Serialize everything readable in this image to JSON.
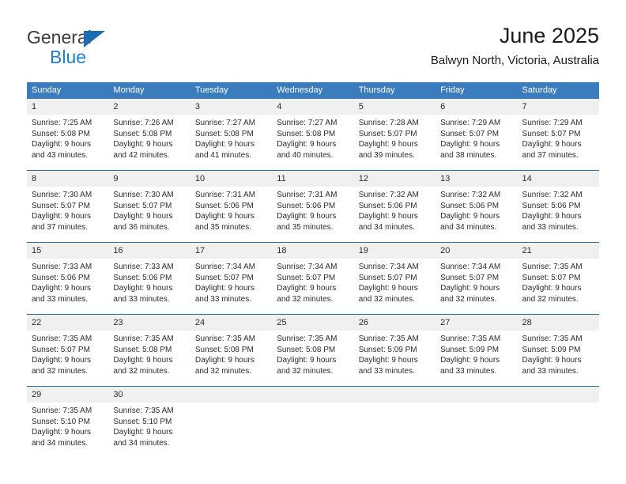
{
  "brand": {
    "name_top": "General",
    "name_bottom": "Blue",
    "accent_color": "#1b7fd4",
    "triangle_color": "#1b6cb3"
  },
  "header": {
    "title": "June 2025",
    "subtitle": "Balwyn North, Victoria, Australia"
  },
  "calendar": {
    "header_bg": "#3a7cbe",
    "header_text_color": "#ffffff",
    "daynum_bg": "#f0f0f0",
    "weekday_headers": [
      "Sunday",
      "Monday",
      "Tuesday",
      "Wednesday",
      "Thursday",
      "Friday",
      "Saturday"
    ],
    "weeks": [
      [
        {
          "day": "1",
          "sunrise": "Sunrise: 7:25 AM",
          "sunset": "Sunset: 5:08 PM",
          "daylight_line1": "Daylight: 9 hours",
          "daylight_line2": "and 43 minutes."
        },
        {
          "day": "2",
          "sunrise": "Sunrise: 7:26 AM",
          "sunset": "Sunset: 5:08 PM",
          "daylight_line1": "Daylight: 9 hours",
          "daylight_line2": "and 42 minutes."
        },
        {
          "day": "3",
          "sunrise": "Sunrise: 7:27 AM",
          "sunset": "Sunset: 5:08 PM",
          "daylight_line1": "Daylight: 9 hours",
          "daylight_line2": "and 41 minutes."
        },
        {
          "day": "4",
          "sunrise": "Sunrise: 7:27 AM",
          "sunset": "Sunset: 5:08 PM",
          "daylight_line1": "Daylight: 9 hours",
          "daylight_line2": "and 40 minutes."
        },
        {
          "day": "5",
          "sunrise": "Sunrise: 7:28 AM",
          "sunset": "Sunset: 5:07 PM",
          "daylight_line1": "Daylight: 9 hours",
          "daylight_line2": "and 39 minutes."
        },
        {
          "day": "6",
          "sunrise": "Sunrise: 7:29 AM",
          "sunset": "Sunset: 5:07 PM",
          "daylight_line1": "Daylight: 9 hours",
          "daylight_line2": "and 38 minutes."
        },
        {
          "day": "7",
          "sunrise": "Sunrise: 7:29 AM",
          "sunset": "Sunset: 5:07 PM",
          "daylight_line1": "Daylight: 9 hours",
          "daylight_line2": "and 37 minutes."
        }
      ],
      [
        {
          "day": "8",
          "sunrise": "Sunrise: 7:30 AM",
          "sunset": "Sunset: 5:07 PM",
          "daylight_line1": "Daylight: 9 hours",
          "daylight_line2": "and 37 minutes."
        },
        {
          "day": "9",
          "sunrise": "Sunrise: 7:30 AM",
          "sunset": "Sunset: 5:07 PM",
          "daylight_line1": "Daylight: 9 hours",
          "daylight_line2": "and 36 minutes."
        },
        {
          "day": "10",
          "sunrise": "Sunrise: 7:31 AM",
          "sunset": "Sunset: 5:06 PM",
          "daylight_line1": "Daylight: 9 hours",
          "daylight_line2": "and 35 minutes."
        },
        {
          "day": "11",
          "sunrise": "Sunrise: 7:31 AM",
          "sunset": "Sunset: 5:06 PM",
          "daylight_line1": "Daylight: 9 hours",
          "daylight_line2": "and 35 minutes."
        },
        {
          "day": "12",
          "sunrise": "Sunrise: 7:32 AM",
          "sunset": "Sunset: 5:06 PM",
          "daylight_line1": "Daylight: 9 hours",
          "daylight_line2": "and 34 minutes."
        },
        {
          "day": "13",
          "sunrise": "Sunrise: 7:32 AM",
          "sunset": "Sunset: 5:06 PM",
          "daylight_line1": "Daylight: 9 hours",
          "daylight_line2": "and 34 minutes."
        },
        {
          "day": "14",
          "sunrise": "Sunrise: 7:32 AM",
          "sunset": "Sunset: 5:06 PM",
          "daylight_line1": "Daylight: 9 hours",
          "daylight_line2": "and 33 minutes."
        }
      ],
      [
        {
          "day": "15",
          "sunrise": "Sunrise: 7:33 AM",
          "sunset": "Sunset: 5:06 PM",
          "daylight_line1": "Daylight: 9 hours",
          "daylight_line2": "and 33 minutes."
        },
        {
          "day": "16",
          "sunrise": "Sunrise: 7:33 AM",
          "sunset": "Sunset: 5:06 PM",
          "daylight_line1": "Daylight: 9 hours",
          "daylight_line2": "and 33 minutes."
        },
        {
          "day": "17",
          "sunrise": "Sunrise: 7:34 AM",
          "sunset": "Sunset: 5:07 PM",
          "daylight_line1": "Daylight: 9 hours",
          "daylight_line2": "and 33 minutes."
        },
        {
          "day": "18",
          "sunrise": "Sunrise: 7:34 AM",
          "sunset": "Sunset: 5:07 PM",
          "daylight_line1": "Daylight: 9 hours",
          "daylight_line2": "and 32 minutes."
        },
        {
          "day": "19",
          "sunrise": "Sunrise: 7:34 AM",
          "sunset": "Sunset: 5:07 PM",
          "daylight_line1": "Daylight: 9 hours",
          "daylight_line2": "and 32 minutes."
        },
        {
          "day": "20",
          "sunrise": "Sunrise: 7:34 AM",
          "sunset": "Sunset: 5:07 PM",
          "daylight_line1": "Daylight: 9 hours",
          "daylight_line2": "and 32 minutes."
        },
        {
          "day": "21",
          "sunrise": "Sunrise: 7:35 AM",
          "sunset": "Sunset: 5:07 PM",
          "daylight_line1": "Daylight: 9 hours",
          "daylight_line2": "and 32 minutes."
        }
      ],
      [
        {
          "day": "22",
          "sunrise": "Sunrise: 7:35 AM",
          "sunset": "Sunset: 5:07 PM",
          "daylight_line1": "Daylight: 9 hours",
          "daylight_line2": "and 32 minutes."
        },
        {
          "day": "23",
          "sunrise": "Sunrise: 7:35 AM",
          "sunset": "Sunset: 5:08 PM",
          "daylight_line1": "Daylight: 9 hours",
          "daylight_line2": "and 32 minutes."
        },
        {
          "day": "24",
          "sunrise": "Sunrise: 7:35 AM",
          "sunset": "Sunset: 5:08 PM",
          "daylight_line1": "Daylight: 9 hours",
          "daylight_line2": "and 32 minutes."
        },
        {
          "day": "25",
          "sunrise": "Sunrise: 7:35 AM",
          "sunset": "Sunset: 5:08 PM",
          "daylight_line1": "Daylight: 9 hours",
          "daylight_line2": "and 32 minutes."
        },
        {
          "day": "26",
          "sunrise": "Sunrise: 7:35 AM",
          "sunset": "Sunset: 5:09 PM",
          "daylight_line1": "Daylight: 9 hours",
          "daylight_line2": "and 33 minutes."
        },
        {
          "day": "27",
          "sunrise": "Sunrise: 7:35 AM",
          "sunset": "Sunset: 5:09 PM",
          "daylight_line1": "Daylight: 9 hours",
          "daylight_line2": "and 33 minutes."
        },
        {
          "day": "28",
          "sunrise": "Sunrise: 7:35 AM",
          "sunset": "Sunset: 5:09 PM",
          "daylight_line1": "Daylight: 9 hours",
          "daylight_line2": "and 33 minutes."
        }
      ],
      [
        {
          "day": "29",
          "sunrise": "Sunrise: 7:35 AM",
          "sunset": "Sunset: 5:10 PM",
          "daylight_line1": "Daylight: 9 hours",
          "daylight_line2": "and 34 minutes."
        },
        {
          "day": "30",
          "sunrise": "Sunrise: 7:35 AM",
          "sunset": "Sunset: 5:10 PM",
          "daylight_line1": "Daylight: 9 hours",
          "daylight_line2": "and 34 minutes."
        },
        {
          "day": "",
          "sunrise": "",
          "sunset": "",
          "daylight_line1": "",
          "daylight_line2": ""
        },
        {
          "day": "",
          "sunrise": "",
          "sunset": "",
          "daylight_line1": "",
          "daylight_line2": ""
        },
        {
          "day": "",
          "sunrise": "",
          "sunset": "",
          "daylight_line1": "",
          "daylight_line2": ""
        },
        {
          "day": "",
          "sunrise": "",
          "sunset": "",
          "daylight_line1": "",
          "daylight_line2": ""
        },
        {
          "day": "",
          "sunrise": "",
          "sunset": "",
          "daylight_line1": "",
          "daylight_line2": ""
        }
      ]
    ]
  }
}
